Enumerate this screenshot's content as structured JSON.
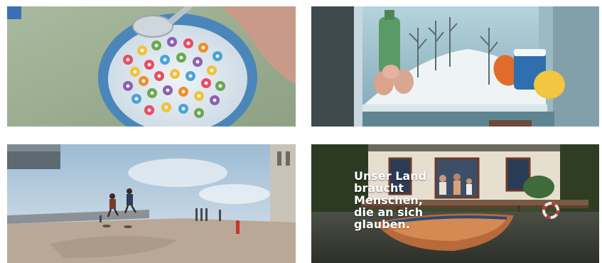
{
  "frames": [
    {
      "id": "cereal-bowl-frame"
    },
    {
      "id": "fridge-winter-frame"
    },
    {
      "id": "street-runners-frame"
    },
    {
      "id": "lake-house-frame",
      "caption": {
        "line1": "Unser Land",
        "line2": "braucht",
        "line3": "Menschen,",
        "line4": "die an sich",
        "line5": "glauben."
      }
    }
  ]
}
